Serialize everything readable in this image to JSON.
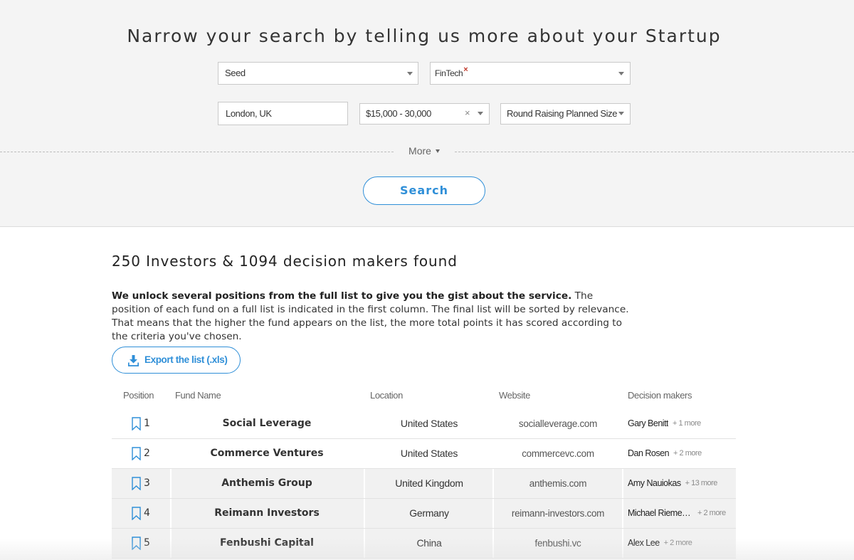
{
  "search": {
    "title": "Narrow your search by telling us more about your Startup",
    "stage": {
      "value": "Seed"
    },
    "industry": {
      "tag": "FinTech",
      "remove_glyph": "×"
    },
    "location": {
      "value": "London, UK"
    },
    "amount": {
      "value": "$15,000 - 30,000",
      "clear_glyph": "×"
    },
    "round_size": {
      "value": "Round Raising Planned Size"
    },
    "more_label": "More",
    "search_label": "Search"
  },
  "results": {
    "count_text": "250 Investors & 1094 decision makers found",
    "desc_bold": "We unlock several positions from the full list to give you the gist about the service.",
    "desc_rest": " The position of each fund on a full list is indicated in the first column. The final list will be sorted by relevance. That means that the higher the fund appears on the list, the more total points it has scored according to the criteria you've chosen.",
    "export_label": "Export the list (.xls)",
    "export_icon": "download-icon",
    "columns": {
      "position": "Position",
      "fund_name": "Fund Name",
      "location": "Location",
      "website": "Website",
      "decision_makers": "Decision makers"
    },
    "rows": [
      {
        "position": "1",
        "fund": "Social Leverage",
        "location": "United States",
        "website": "socialleverage.com",
        "maker": "Gary Benitt",
        "more": "+ 1 more"
      },
      {
        "position": "2",
        "fund": "Commerce Ventures",
        "location": "United States",
        "website": "commercevc.com",
        "maker": "Dan Rosen",
        "more": "+ 2 more"
      },
      {
        "position": "3",
        "fund": "Anthemis Group",
        "location": "United Kingdom",
        "website": "anthemis.com",
        "maker": "Amy Nauiokas",
        "more": "+ 13 more"
      },
      {
        "position": "4",
        "fund": "Reimann Investors",
        "location": "Germany",
        "website": "reimann-investors.com",
        "maker": "Michael Riemenschneider",
        "more": "+ 2 more"
      },
      {
        "position": "5",
        "fund": "Fenbushi Capital",
        "location": "China",
        "website": "fenbushi.vc",
        "maker": "Alex Lee",
        "more": "+ 2 more"
      }
    ]
  },
  "colors": {
    "accent": "#2f8fd8",
    "panel_bg": "#f4f4f4",
    "remove_tag": "#c0392b"
  }
}
